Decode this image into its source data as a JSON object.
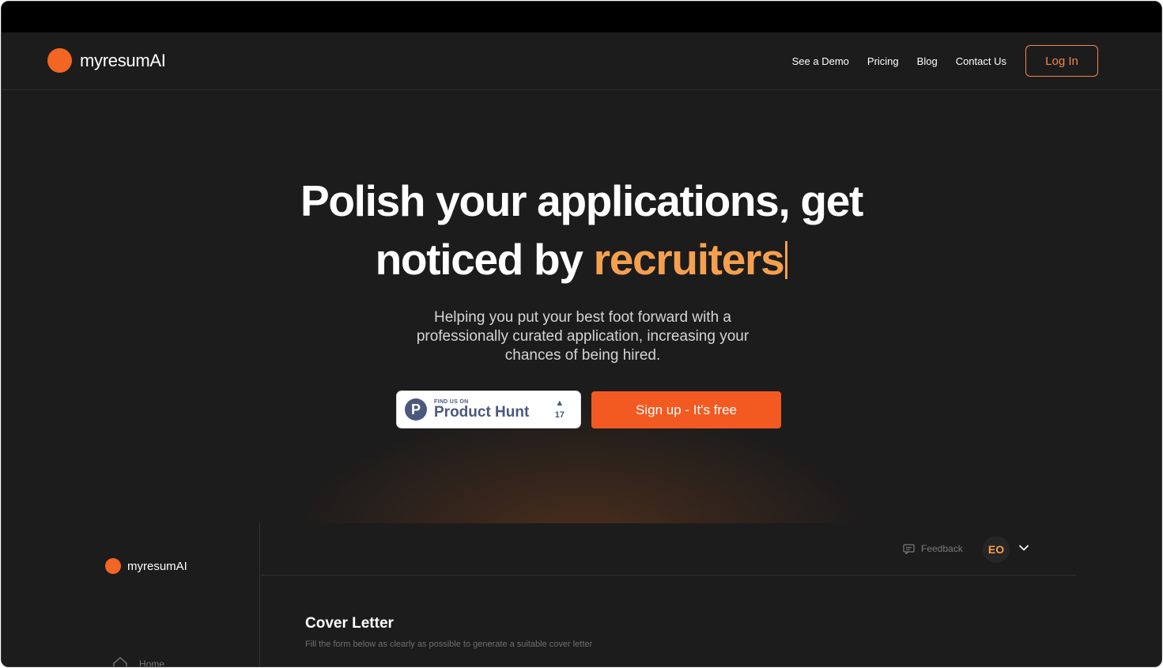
{
  "brand": {
    "name": "myresumAI",
    "accent": "#f26522"
  },
  "nav": {
    "items": [
      "See a Demo",
      "Pricing",
      "Blog",
      "Contact Us"
    ],
    "login_label": "Log In"
  },
  "hero": {
    "title_line1": "Polish your applications, get",
    "title_line2_prefix": "noticed by ",
    "title_highlight": "recruiters",
    "subtitle": "Helping you put your best foot forward with a professionally curated application, increasing your chances of being hired.",
    "product_hunt": {
      "small_text": "FIND US ON",
      "big_text": "Product Hunt",
      "letter": "P",
      "vote_count": "17"
    },
    "signup_label": "Sign up - It's free"
  },
  "preview": {
    "sidebar": {
      "brand": "myresumAI",
      "home_label": "Home"
    },
    "topbar": {
      "feedback_label": "Feedback",
      "avatar_initials": "EO"
    },
    "main": {
      "title": "Cover Letter",
      "subtitle": "Fill the form below as clearly as possible to generate a suitable cover letter"
    }
  }
}
